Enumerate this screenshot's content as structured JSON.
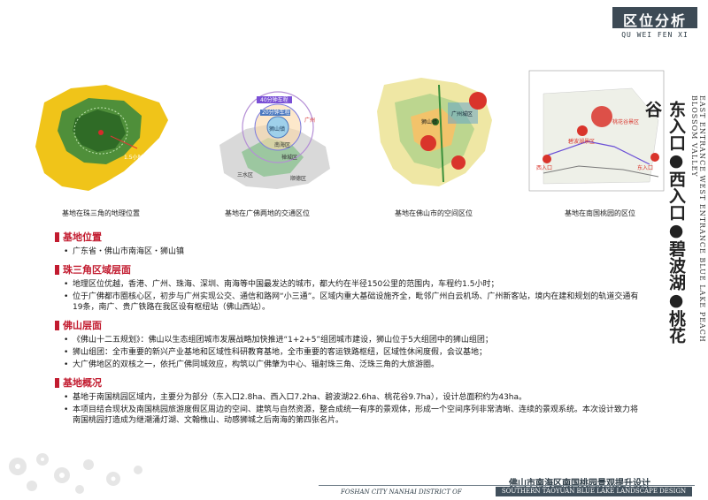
{
  "header": {
    "title": "区位分析",
    "subtitle": "QU WEI FEN XI"
  },
  "maps": [
    {
      "caption": "基地在珠三角的地理位置",
      "label": "1.5小时车程"
    },
    {
      "caption": "基地在广佛两地的交通区位",
      "labels": [
        "40分钟车程",
        "20分钟车程",
        "狮山镇",
        "南海区",
        "禅城区",
        "顺德区",
        "三水区",
        "广州"
      ]
    },
    {
      "caption": "基地在佛山市的空间区位",
      "labels": [
        "广州城区",
        "狮山镇"
      ]
    },
    {
      "caption": "基地在南国桃园的区位",
      "labels": [
        "西入口",
        "东入口",
        "碧波湖景区",
        "桃花谷景区"
      ]
    }
  ],
  "side": {
    "cn": "东入口●西入口●碧波湖●桃花谷",
    "en": "EAST ENTRANCE WEST ENTRANCE BLUE LAKE PEACH BLOSSOM VALLEY"
  },
  "sections": [
    {
      "title": "基地位置",
      "items": [
        "广东省・佛山市南海区・狮山镇"
      ]
    },
    {
      "title": "珠三角区域层面",
      "items": [
        "地理区位优越，香港、广州、珠海、深圳、南海等中国最发达的城市，都大约在半径150公里的范围内，车程约1.5小时；",
        "位于广佛都市圈核心区，初步与广州实现公交、通信和路网“小三通”。区域内重大基础设施齐全，毗邻广州白云机场、广州新客站，境内在建和规划的轨道交通有19条，南广、贵广铁路在我区设有枢纽站（佛山西站）。"
      ]
    },
    {
      "title": "佛山层面",
      "items": [
        "《佛山十二五规划》：佛山以生态组团城市发展战略加快推进“1+2+5”组团城市建设，狮山位于5大组团中的狮山组团；",
        "狮山组团：全市重要的新兴产业基地和区域性科研教育基地，全市重要的客运铁路枢纽，区域性休闲度假，会议基地；",
        "大广佛地区的双核之一，依托广佛同城效应，构筑以广佛肇为中心、辐射珠三角、泛珠三角的大旅游圈。"
      ]
    },
    {
      "title": "基地概况",
      "items": [
        "基地于南国桃园区域内，主要分为部分（东入口2.8ha、西入口7.2ha、碧波湖22.6ha、桃花谷9.7ha），设计总面积约为43ha。",
        "本项目结合现状及南国桃园旅游度假区周边的空间、建筑与自然资源，整合成统一有序的景观体，形成一个空间序列非常清晰、连续的景观系统。本次设计致力将南国桃园打造成为继潮涌灯湖、文翰樵山、动感狮城之后南海的第四张名片。"
      ]
    }
  ],
  "footer": {
    "cn": "佛山市南海区南国桃园景观提升设计",
    "en1": "FOSHAN CITY NANHAI DISTRICT OF",
    "en2": "SOUTHERN TAOYUAN BLUE LAKE LANDSCAPE DESIGN"
  },
  "colors": {
    "accent": "#c21b2f",
    "header_bg": "#3d4a55",
    "green": "#4f8f3a"
  }
}
